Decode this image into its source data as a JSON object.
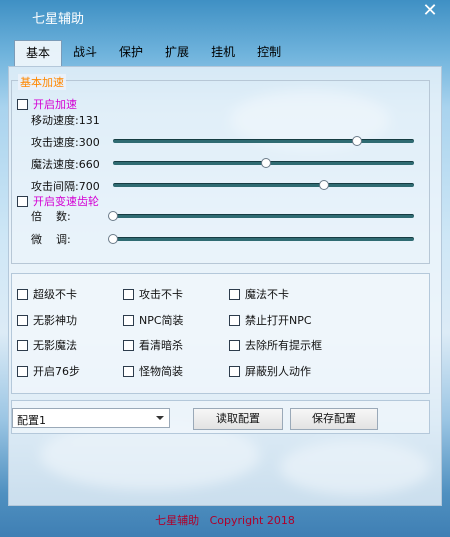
{
  "window": {
    "title": "七星辅助",
    "close_glyph": "✕"
  },
  "tabs": [
    {
      "label": "基本",
      "active": true
    },
    {
      "label": "战斗",
      "active": false
    },
    {
      "label": "保护",
      "active": false
    },
    {
      "label": "扩展",
      "active": false
    },
    {
      "label": "挂机",
      "active": false
    },
    {
      "label": "控制",
      "active": false
    }
  ],
  "basic_speed": {
    "title": "基本加速",
    "enable_speed": {
      "label": "开启加速",
      "checked": false
    },
    "move_speed": {
      "label": "移动速度:131"
    },
    "attack_speed": {
      "label": "攻击速度:300",
      "value": 300,
      "max": 370
    },
    "magic_speed": {
      "label": "魔法速度:660",
      "value": 660,
      "max": 1300
    },
    "attack_interval": {
      "label": "攻击间隔:700",
      "value": 700,
      "max": 1000
    },
    "enable_gear": {
      "label": "开启变速齿轮",
      "checked": false
    },
    "multiplier": {
      "label": "倍    数:",
      "value": 0
    },
    "fine_tune": {
      "label": "微    调:",
      "value": 0
    }
  },
  "options": [
    {
      "label": "超级不卡",
      "checked": false
    },
    {
      "label": "攻击不卡",
      "checked": false
    },
    {
      "label": "魔法不卡",
      "checked": false
    },
    {
      "label": "无影神功",
      "checked": false
    },
    {
      "label": "NPC简装",
      "checked": false
    },
    {
      "label": "禁止打开NPC",
      "checked": false
    },
    {
      "label": "无影魔法",
      "checked": false
    },
    {
      "label": "看清暗杀",
      "checked": false
    },
    {
      "label": "去除所有提示框",
      "checked": false
    },
    {
      "label": "开启76步",
      "checked": false
    },
    {
      "label": "怪物简装",
      "checked": false
    },
    {
      "label": "屏蔽别人动作",
      "checked": false
    }
  ],
  "config": {
    "selected": "配置1",
    "load_label": "读取配置",
    "save_label": "保存配置"
  },
  "footer": {
    "text": "七星辅助   Copyright 2018"
  }
}
